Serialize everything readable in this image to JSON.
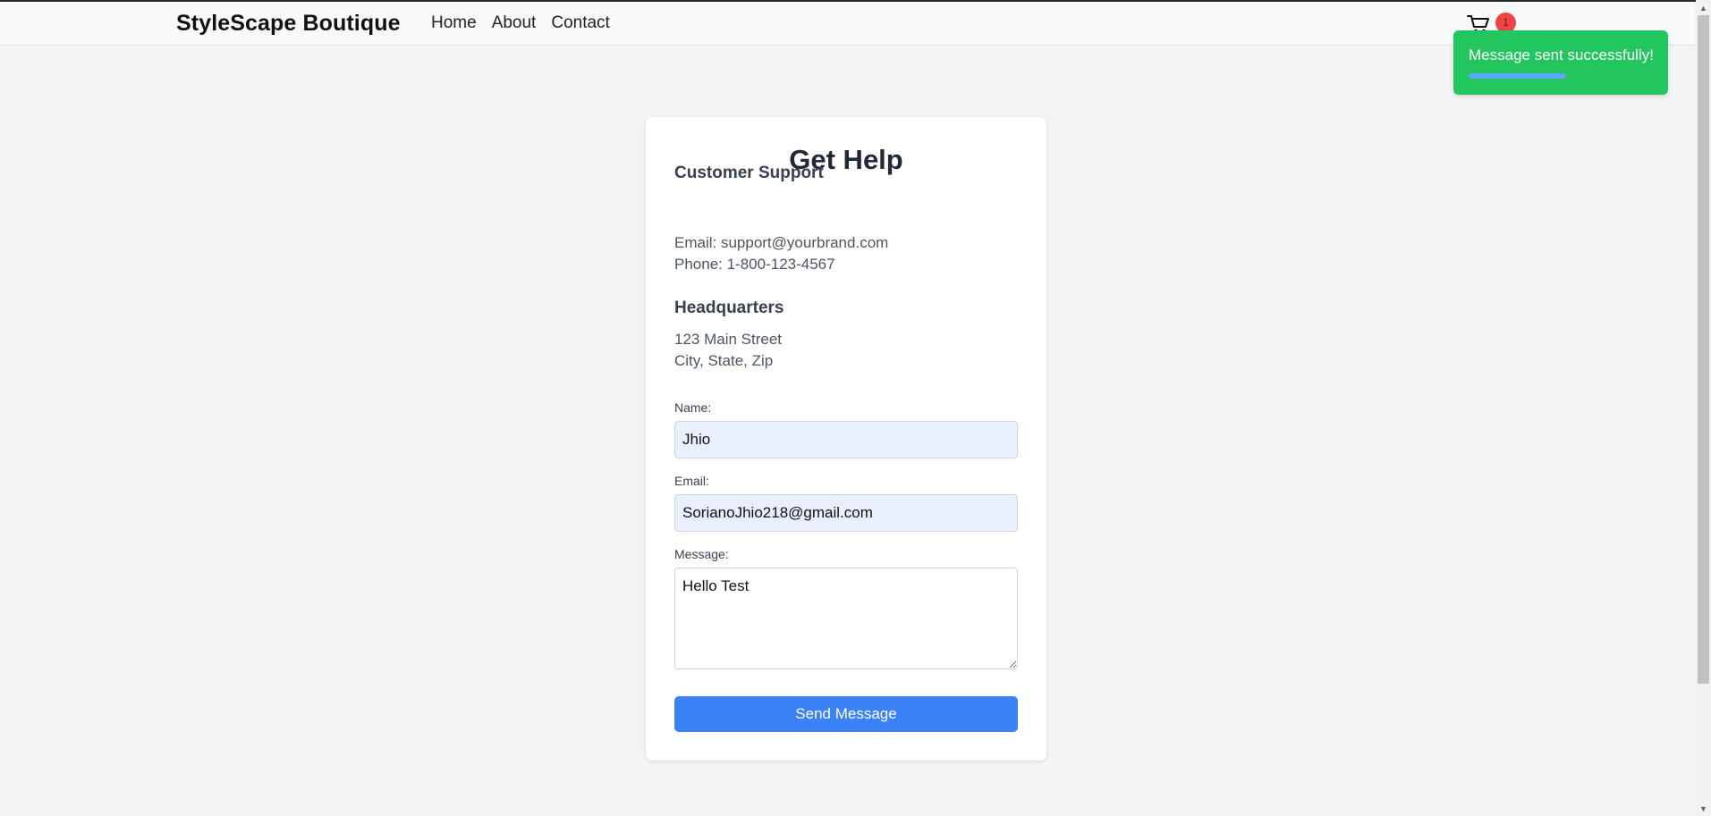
{
  "navbar": {
    "brand": "StyleScape Boutique",
    "links": [
      "Home",
      "About",
      "Contact"
    ],
    "cart": {
      "icon": "cart-icon",
      "count": "1"
    }
  },
  "toast": {
    "message": "Message sent successfully!",
    "progress": 0.53,
    "color": "#22c55e"
  },
  "card": {
    "title": "Get Help",
    "support": {
      "heading": "Customer Support",
      "email_line": "Email: support@yourbrand.com",
      "phone_line": "Phone: 1-800-123-4567"
    },
    "headquarters": {
      "heading": "Headquarters",
      "address_line1": "123 Main Street",
      "address_line2": "City, State, Zip"
    },
    "form": {
      "name_label": "Name:",
      "name_value": "Jhio",
      "email_label": "Email:",
      "email_value": "SorianoJhio218@gmail.com",
      "message_label": "Message:",
      "message_value": "Hello Test",
      "submit_label": "Send Message"
    }
  },
  "colors": {
    "accent": "#3b82f6",
    "badge": "#ef4444",
    "background": "#f3f4f6"
  }
}
